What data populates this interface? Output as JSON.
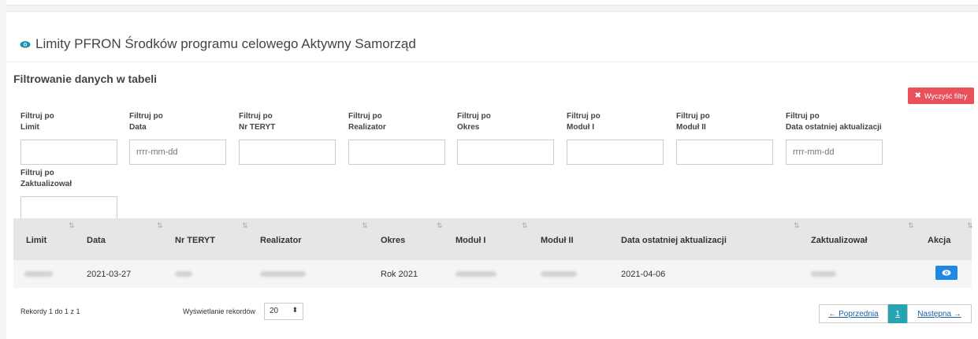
{
  "panel": {
    "title": "Limity PFRON Środków programu celowego Aktywny Samorząd"
  },
  "filters": {
    "title": "Filtrowanie danych w tabeli",
    "clear_label": "Wyczyść filtry",
    "fields": [
      {
        "label": "Filtruj po\nLimit",
        "placeholder": ""
      },
      {
        "label": "Filtruj po\nData",
        "placeholder": "rrrr-mm-dd"
      },
      {
        "label": "Filtruj po\nNr TERYT",
        "placeholder": ""
      },
      {
        "label": "Filtruj po\nRealizator",
        "placeholder": ""
      },
      {
        "label": "Filtruj po\nOkres",
        "placeholder": ""
      },
      {
        "label": "Filtruj po\nModuł I",
        "placeholder": ""
      },
      {
        "label": "Filtruj po\nModuł II",
        "placeholder": ""
      },
      {
        "label": "Filtruj po\nData ostatniej aktualizacji",
        "placeholder": "rrrr-mm-dd"
      },
      {
        "label": "Filtruj po\nZaktualizował",
        "placeholder": ""
      }
    ]
  },
  "table": {
    "columns": [
      "Limit",
      "Data",
      "Nr TERYT",
      "Realizator",
      "Okres",
      "Moduł I",
      "Moduł II",
      "Data ostatniej aktualizacji",
      "Zaktualizował",
      "Akcja"
    ],
    "rows": [
      {
        "data": "2021-03-27",
        "okres": "Rok 2021",
        "data_aktualizacji": "2021-04-06"
      }
    ]
  },
  "footer": {
    "records_info": "Rekordy 1 do 1 z 1",
    "show_label": "Wyświetlanie rekordów",
    "page_size": "20",
    "prev_label": "← Poprzednia",
    "current_page": "1",
    "next_label": "Następna →"
  },
  "colors": {
    "clear_button": "#e9505a",
    "view_button": "#1e88e5",
    "active_page": "#27a4b2"
  }
}
